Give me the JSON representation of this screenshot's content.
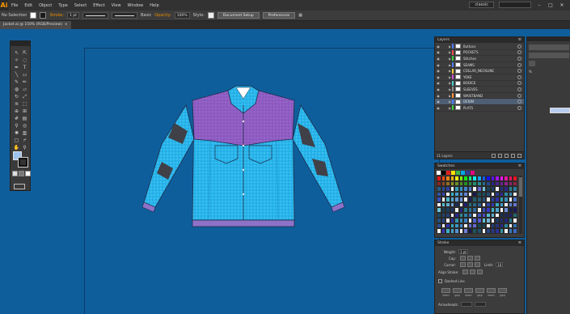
{
  "menubar": {
    "app_logo": "Ai",
    "items": [
      "File",
      "Edit",
      "Object",
      "Type",
      "Select",
      "Effect",
      "View",
      "Window",
      "Help"
    ],
    "workspace": "classic",
    "window_buttons": [
      "–",
      "□",
      "✕"
    ]
  },
  "controlbar": {
    "selection_text": "No Selection",
    "stroke_label": "Stroke:",
    "stroke_value": "1 pt",
    "stroke_profile": "Uniform",
    "brush_value": "Basic",
    "opacity_label": "Opacity:",
    "opacity_value": "100%",
    "style_label": "Style:",
    "document_setup_button": "Document Setup",
    "preferences_button": "Preferences",
    "fill_color": "#ffffff",
    "stroke_color": "#1a1a1a"
  },
  "tabbar": {
    "doc_title": "Jacket.ai @ 150% (RGB/Preview)",
    "close_glyph": "×"
  },
  "tools": {
    "icons": [
      "selection-tool",
      "direct-selection-tool",
      "magic-wand-tool",
      "lasso-tool",
      "pen-tool",
      "type-tool",
      "line-tool",
      "rectangle-tool",
      "paintbrush-tool",
      "pencil-tool",
      "blob-brush-tool",
      "eraser-tool",
      "rotate-tool",
      "scale-tool",
      "width-tool",
      "free-transform-tool",
      "shape-builder-tool",
      "perspective-grid-tool",
      "mesh-tool",
      "gradient-tool",
      "eyedropper-tool",
      "blend-tool",
      "symbol-sprayer-tool",
      "column-graph-tool",
      "artboard-tool",
      "slice-tool",
      "hand-tool",
      "zoom-tool"
    ],
    "fill_color": "#9ec2ef"
  },
  "layers_panel": {
    "title": "Layers",
    "menu_glyph": "≡",
    "layers": [
      {
        "name": "Buttons",
        "color": "#4f7cff",
        "selected": false
      },
      {
        "name": "POCKETS",
        "color": "#ff4f4f",
        "selected": false
      },
      {
        "name": "Stitches",
        "color": "#3fcf3f",
        "selected": false
      },
      {
        "name": "SEAMS",
        "color": "#4f7cff",
        "selected": false
      },
      {
        "name": "COLLAR_NECKLINE",
        "color": "#ffcf3f",
        "selected": false
      },
      {
        "name": "YOKE",
        "color": "#cf4fcf",
        "selected": false
      },
      {
        "name": "BODICE",
        "color": "#4fcfcf",
        "selected": false
      },
      {
        "name": "SLEEVES",
        "color": "#8f8f8f",
        "selected": false
      },
      {
        "name": "WAISTBAND",
        "color": "#ff8f3f",
        "selected": false
      },
      {
        "name": "DENIM",
        "color": "#4f7cff",
        "selected": true
      },
      {
        "name": "PLATS",
        "color": "#3fcf3f",
        "selected": false
      }
    ],
    "footer_text": "11 Layers"
  },
  "swatches_panel": {
    "title": "Swatches",
    "menu_glyph": "≡"
  },
  "stroke_panel": {
    "title": "Stroke",
    "menu_glyph": "≡",
    "weight_label": "Weight:",
    "weight_value": "1 pt",
    "cap_label": "Cap:",
    "corner_label": "Corner:",
    "limit_label": "Limit:",
    "limit_value": "10",
    "align_label": "Align Stroke:",
    "dashed_label": "Dashed Line",
    "dash_labels": [
      "dash",
      "gap",
      "dash",
      "gap",
      "dash",
      "gap"
    ],
    "arrowheads_label": "Arrowheads:"
  },
  "rightstrip": {
    "pct": "%"
  },
  "colors": {
    "canvas": "#0f5e9c",
    "denim": "#27b4ea",
    "yoke": "#8e5cc2",
    "stripe": "#404048",
    "waistband": "#8e72c8"
  }
}
